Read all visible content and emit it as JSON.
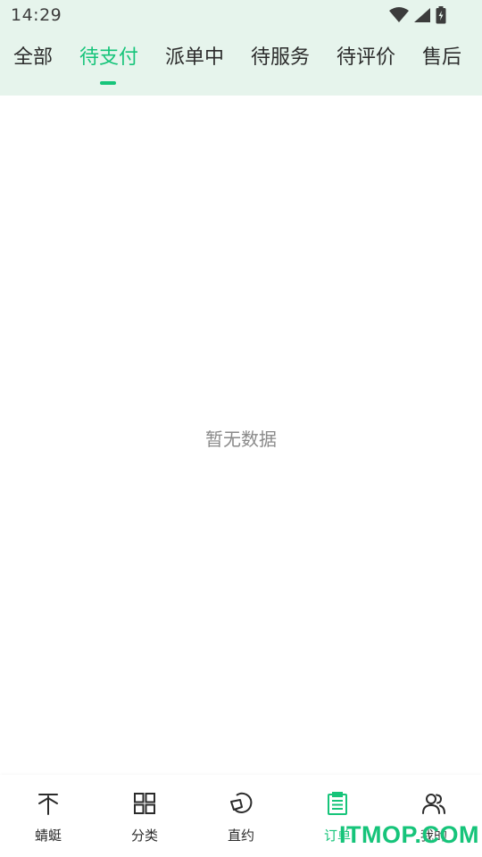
{
  "status_bar": {
    "time": "14:29",
    "icons": [
      "wifi-icon",
      "cellular-signal-icon",
      "battery-charging-icon"
    ]
  },
  "tabs": [
    {
      "label": "全部",
      "active": false
    },
    {
      "label": "待支付",
      "active": true
    },
    {
      "label": "派单中",
      "active": false
    },
    {
      "label": "待服务",
      "active": false
    },
    {
      "label": "待评价",
      "active": false
    },
    {
      "label": "售后",
      "active": false
    }
  ],
  "empty_state": {
    "text": "暂无数据"
  },
  "bottom_nav": [
    {
      "label": "蜻蜓",
      "icon": "dragonfly-icon",
      "active": false
    },
    {
      "label": "分类",
      "icon": "grid-icon",
      "active": false
    },
    {
      "label": "直约",
      "icon": "chat-bubble-icon",
      "active": false
    },
    {
      "label": "订单",
      "icon": "clipboard-list-icon",
      "active": true
    },
    {
      "label": "我的",
      "icon": "user-group-icon",
      "active": false
    }
  ],
  "watermark": {
    "text": "ITMOP.COM"
  },
  "colors": {
    "accent": "#16c47a",
    "header_bg": "#e6f4ec",
    "text": "#2b2b2b",
    "muted": "#8a8a8a"
  }
}
